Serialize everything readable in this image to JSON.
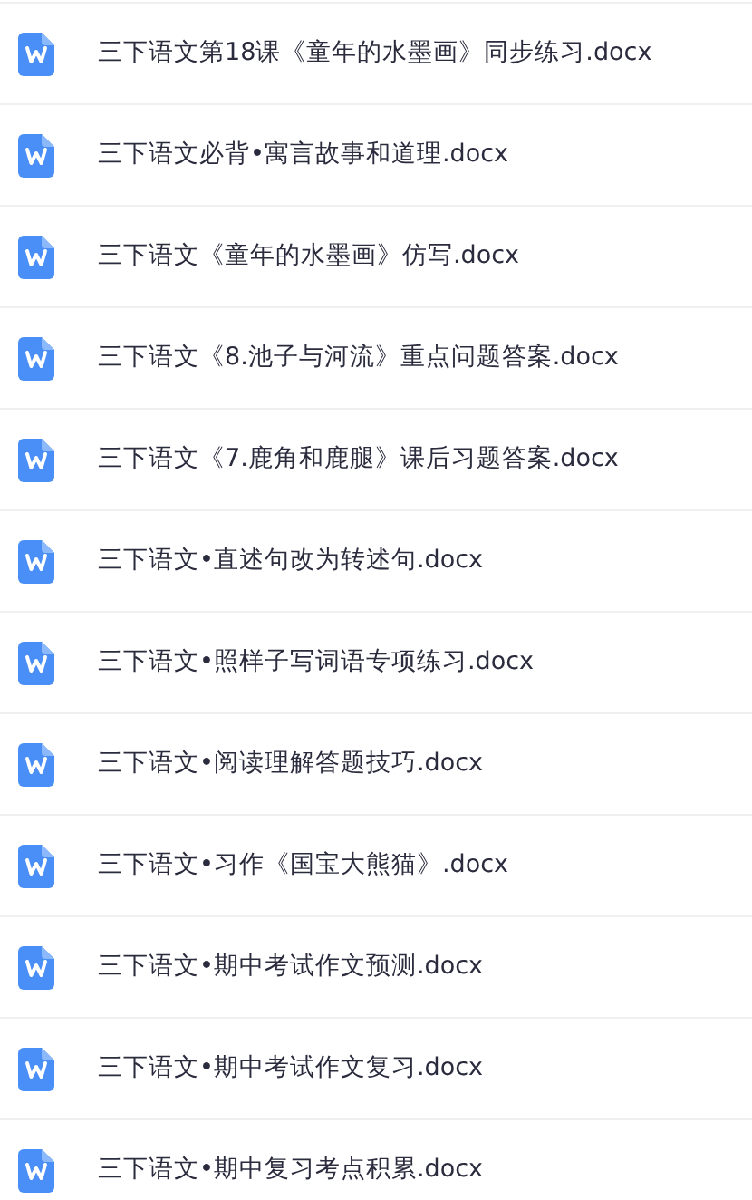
{
  "files": [
    {
      "name": "三下语文第18课《童年的水墨画》同步练习.docx"
    },
    {
      "name": "三下语文必背•寓言故事和道理.docx"
    },
    {
      "name": "三下语文《童年的水墨画》仿写.docx"
    },
    {
      "name": "三下语文《8.池子与河流》重点问题答案.docx"
    },
    {
      "name": "三下语文《7.鹿角和鹿腿》课后习题答案.docx"
    },
    {
      "name": "三下语文•直述句改为转述句.docx"
    },
    {
      "name": "三下语文•照样子写词语专项练习.docx"
    },
    {
      "name": "三下语文•阅读理解答题技巧.docx"
    },
    {
      "name": "三下语文•习作《国宝大熊猫》.docx"
    },
    {
      "name": "三下语文•期中考试作文预测.docx"
    },
    {
      "name": "三下语文•期中考试作文复习.docx"
    },
    {
      "name": "三下语文•期中复习考点积累.docx"
    }
  ]
}
